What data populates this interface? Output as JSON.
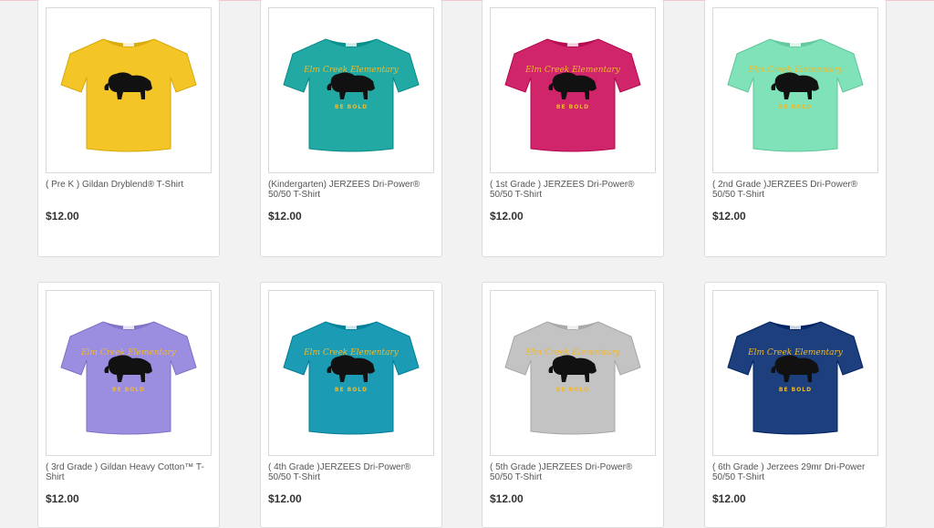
{
  "products": [
    {
      "title": "( Pre K ) Gildan Dryblend® T-Shirt",
      "price": "$12.00",
      "shirt_color": "#f3c526",
      "print_text": "",
      "print_subtext": "",
      "has_print_text": false,
      "icon": "tshirt-icon"
    },
    {
      "title": "(Kindergarten) JERZEES Dri-Power® 50/50 T-Shirt",
      "price": "$12.00",
      "shirt_color": "#22a9a4",
      "print_text": "Elm Creek Elementary",
      "print_subtext": "BE BOLD",
      "has_print_text": true,
      "icon": "tshirt-icon"
    },
    {
      "title": "( 1st Grade ) JERZEES Dri-Power® 50/50 T-Shirt",
      "price": "$12.00",
      "shirt_color": "#d0246b",
      "print_text": "Elm Creek Elementary",
      "print_subtext": "BE BOLD",
      "has_print_text": true,
      "icon": "tshirt-icon"
    },
    {
      "title": "( 2nd Grade )JERZEES Dri-Power® 50/50 T-Shirt",
      "price": "$12.00",
      "shirt_color": "#7fe2b8",
      "print_text": "Elm Creek Elementary",
      "print_subtext": "BE BOLD",
      "has_print_text": true,
      "icon": "tshirt-icon"
    },
    {
      "title": "( 3rd Grade ) Gildan Heavy Cotton™ T-Shirt",
      "price": "$12.00",
      "shirt_color": "#9b8ee0",
      "print_text": "Elm Creek Elementary",
      "print_subtext": "BE BOLD",
      "has_print_text": true,
      "icon": "tshirt-icon"
    },
    {
      "title": "( 4th Grade )JERZEES Dri-Power® 50/50 T-Shirt",
      "price": "$12.00",
      "shirt_color": "#1c9bb5",
      "print_text": "Elm Creek Elementary",
      "print_subtext": "BE BOLD",
      "has_print_text": true,
      "icon": "tshirt-icon"
    },
    {
      "title": "( 5th Grade )JERZEES Dri-Power® 50/50 T-Shirt",
      "price": "$12.00",
      "shirt_color": "#c3c3c3",
      "print_text": "Elm Creek Elementary",
      "print_subtext": "BE BOLD",
      "has_print_text": true,
      "icon": "tshirt-icon"
    },
    {
      "title": "( 6th Grade ) Jerzees 29mr Dri-Power 50/50 T-Shirt",
      "price": "$12.00",
      "shirt_color": "#1d3f7e",
      "print_text": "Elm Creek Elementary",
      "print_subtext": "BE BOLD",
      "has_print_text": true,
      "icon": "tshirt-icon"
    }
  ]
}
